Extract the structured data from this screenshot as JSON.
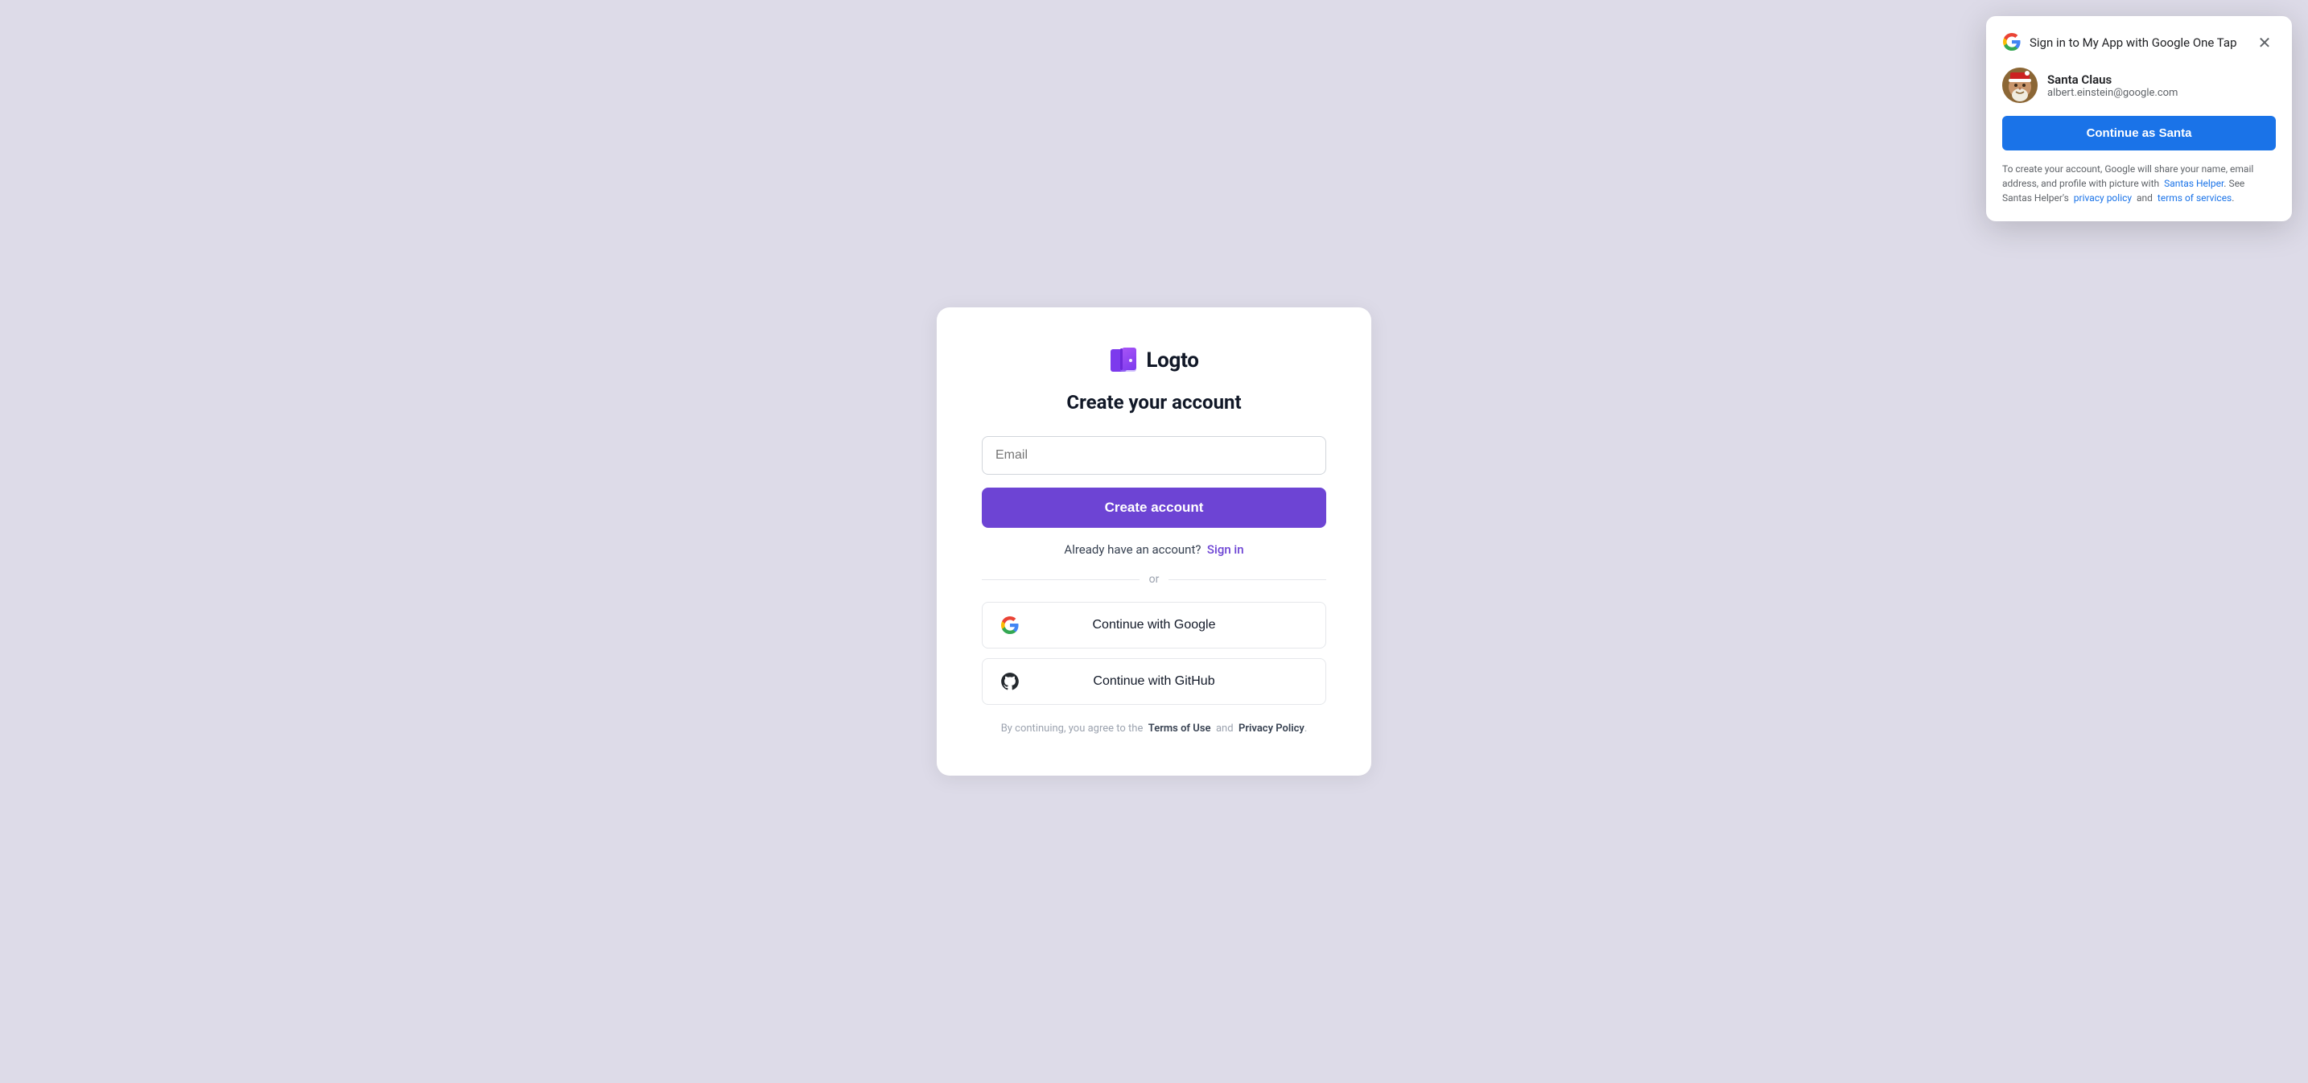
{
  "page": {
    "background_color": "#dddbe8"
  },
  "auth_card": {
    "logo": {
      "text": "Logto",
      "icon_name": "logto-logo-icon"
    },
    "title": "Create your account",
    "email_input": {
      "placeholder": "Email"
    },
    "create_button": {
      "label": "Create account"
    },
    "signin_prompt": {
      "text": "Already have an account?",
      "link_label": "Sign in"
    },
    "divider": {
      "text": "or"
    },
    "social_buttons": [
      {
        "id": "google",
        "label": "Continue with Google",
        "icon_name": "google-icon"
      },
      {
        "id": "github",
        "label": "Continue with GitHub",
        "icon_name": "github-icon"
      }
    ],
    "terms": {
      "prefix": "By continuing, you agree to the",
      "terms_label": "Terms of Use",
      "connector": "and",
      "privacy_label": "Privacy Policy",
      "suffix": "."
    }
  },
  "one_tap": {
    "title": "Sign in to My App with Google One Tap",
    "user": {
      "name": "Santa Claus",
      "email": "albert.einstein@google.com"
    },
    "continue_button_label": "Continue as Santa",
    "disclaimer_prefix": "To create your account, Google will share your name, email address, and profile with picture with",
    "app_link_label": "Santas Helper",
    "disclaimer_middle": ". See Santas Helper's",
    "privacy_link_label": "privacy policy",
    "disclaimer_and": "and",
    "terms_link_label": "terms of services",
    "disclaimer_suffix": "."
  }
}
